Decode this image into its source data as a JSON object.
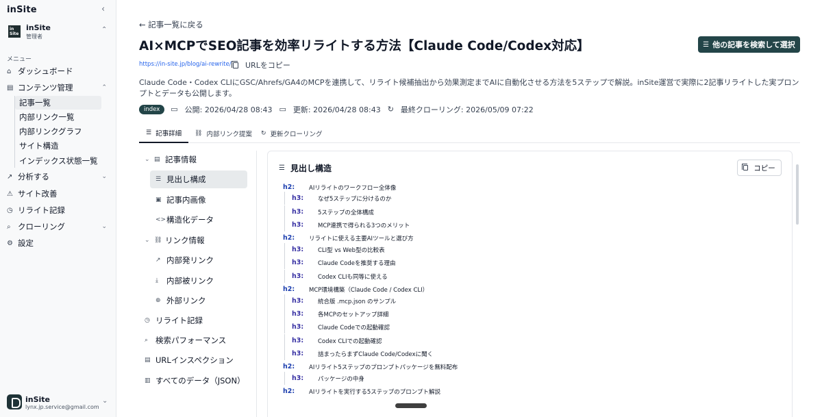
{
  "sidebar": {
    "brand": "inSite",
    "collapse_icon": "chevron-left-icon",
    "workspace": {
      "logo": "in Site",
      "name": "inSite",
      "role": "管理者"
    },
    "menu_label": "メニュー",
    "items": [
      {
        "label": "ダッシュボード",
        "icon": "home-icon"
      },
      {
        "label": "コンテンツ管理",
        "icon": "document-icon"
      },
      {
        "label": "分析する",
        "icon": "trend-icon"
      },
      {
        "label": "サイト改善",
        "icon": "warning-icon"
      },
      {
        "label": "リライト記録",
        "icon": "history-icon"
      },
      {
        "label": "クローリング",
        "icon": "search-icon"
      },
      {
        "label": "設定",
        "icon": "gear-icon"
      }
    ],
    "sub_items": [
      "記事一覧",
      "内部リンク一覧",
      "内部リンクグラフ",
      "サイト構造",
      "インデックス状態一覧"
    ],
    "user": {
      "name": "inSite",
      "email": "lynx.jp.service@gmail.com"
    }
  },
  "main": {
    "back": "← 記事一覧に戻る",
    "title": "AI×MCPでSEO記事を効率リライトする方法【Claude Code/Codex対応】",
    "search_button": "他の記事を検索して選択",
    "url": "https://in-site.jp/blog/ai-rewrite/",
    "copy_url": "URLをコピー",
    "description": "Claude Code・Codex CLIにGSC/Ahrefs/GA4のMCPを連携して、リライト候補抽出から効果測定までAIに自動化させる方法を5ステップで解説。inSite運営で実際に2記事リライトした実プロンプトとデータも公開します。",
    "badge": "index",
    "published": "公開: 2026/04/28 08:43",
    "updated": "更新: 2026/04/28 08:43",
    "last_crawl": "最終クローリング: 2026/05/09 07:22",
    "tabs": [
      "記事詳細",
      "内部リンク提案",
      "更新クローリング"
    ]
  },
  "detail_nav": [
    {
      "label": "記事情報",
      "icon": "document-icon"
    },
    {
      "label": "見出し構成",
      "icon": "list-icon"
    },
    {
      "label": "記事内画像",
      "icon": "image-icon"
    },
    {
      "label": "構造化データ",
      "icon": "code-icon"
    },
    {
      "label": "リンク情報",
      "icon": "link-icon"
    },
    {
      "label": "内部発リンク",
      "icon": "external-link-icon"
    },
    {
      "label": "内部被リンク",
      "icon": "download-icon"
    },
    {
      "label": "外部リンク",
      "icon": "globe-icon"
    },
    {
      "label": "リライト記録",
      "icon": "history-icon"
    },
    {
      "label": "検索パフォーマンス",
      "icon": "search-icon"
    },
    {
      "label": "URLインスペクション",
      "icon": "file-search-icon"
    },
    {
      "label": "すべてのデータ（JSON）",
      "icon": "file-icon"
    }
  ],
  "panel": {
    "title": "見出し構造",
    "copy_button": "コピー",
    "headings": [
      {
        "level": "h2:",
        "text": "AIリライトのワークフロー全体像"
      },
      {
        "level": "h3:",
        "text": "なぜ5ステップに分けるのか"
      },
      {
        "level": "h3:",
        "text": "5ステップの全体構成"
      },
      {
        "level": "h3:",
        "text": "MCP連携で得られる3つのメリット"
      },
      {
        "level": "h2:",
        "text": "リライトに使える主要AIツールと選び方"
      },
      {
        "level": "h3:",
        "text": "CLI型 vs Web型の比較表"
      },
      {
        "level": "h3:",
        "text": "Claude Codeを推奨する理由"
      },
      {
        "level": "h3:",
        "text": "Codex CLIも同等に使える"
      },
      {
        "level": "h2:",
        "text": "MCP環境構築（Claude Code / Codex CLI）"
      },
      {
        "level": "h3:",
        "text": "統合版 .mcp.json のサンプル"
      },
      {
        "level": "h3:",
        "text": "各MCPのセットアップ詳細"
      },
      {
        "level": "h3:",
        "text": "Claude Codeでの起動確認"
      },
      {
        "level": "h3:",
        "text": "Codex CLIでの起動確認"
      },
      {
        "level": "h3:",
        "text": "詰まったらまずClaude Code/Codexに聞く"
      },
      {
        "level": "h2:",
        "text": "AIリライト5ステップのプロンプトパッケージを無料配布"
      },
      {
        "level": "h3:",
        "text": "パッケージの中身"
      },
      {
        "level": "h2:",
        "text": "AIリライトを実行する5ステップのプロンプト解説"
      }
    ]
  }
}
